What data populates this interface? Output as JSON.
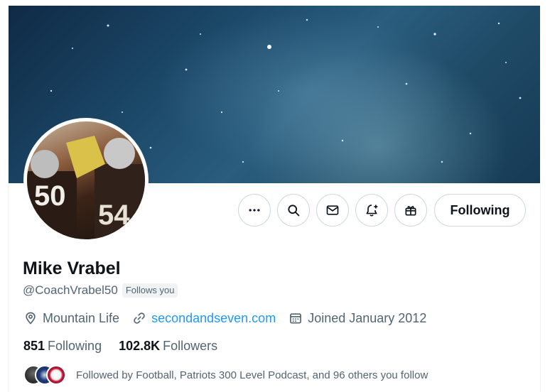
{
  "profile": {
    "display_name": "Mike Vrabel",
    "handle": "@CoachVrabel50",
    "follows_you_badge": "Follows you",
    "location": "Mountain Life",
    "website": "secondandseven.com",
    "joined": "Joined January 2012",
    "following_count": "851",
    "following_label": "Following",
    "followers_count": "102.8K",
    "followers_label": "Followers",
    "followed_by": "Followed by Football, Patriots 300 Level Podcast, and 96 others you follow"
  },
  "actions": {
    "following_button": "Following",
    "icons": [
      "more-icon",
      "search-icon",
      "message-icon",
      "notification-bell-icon",
      "gift-icon"
    ]
  },
  "colors": {
    "link": "#1d9bf0",
    "secondary_text": "#536471",
    "primary_text": "#0f1419",
    "border": "#cfd9de"
  }
}
